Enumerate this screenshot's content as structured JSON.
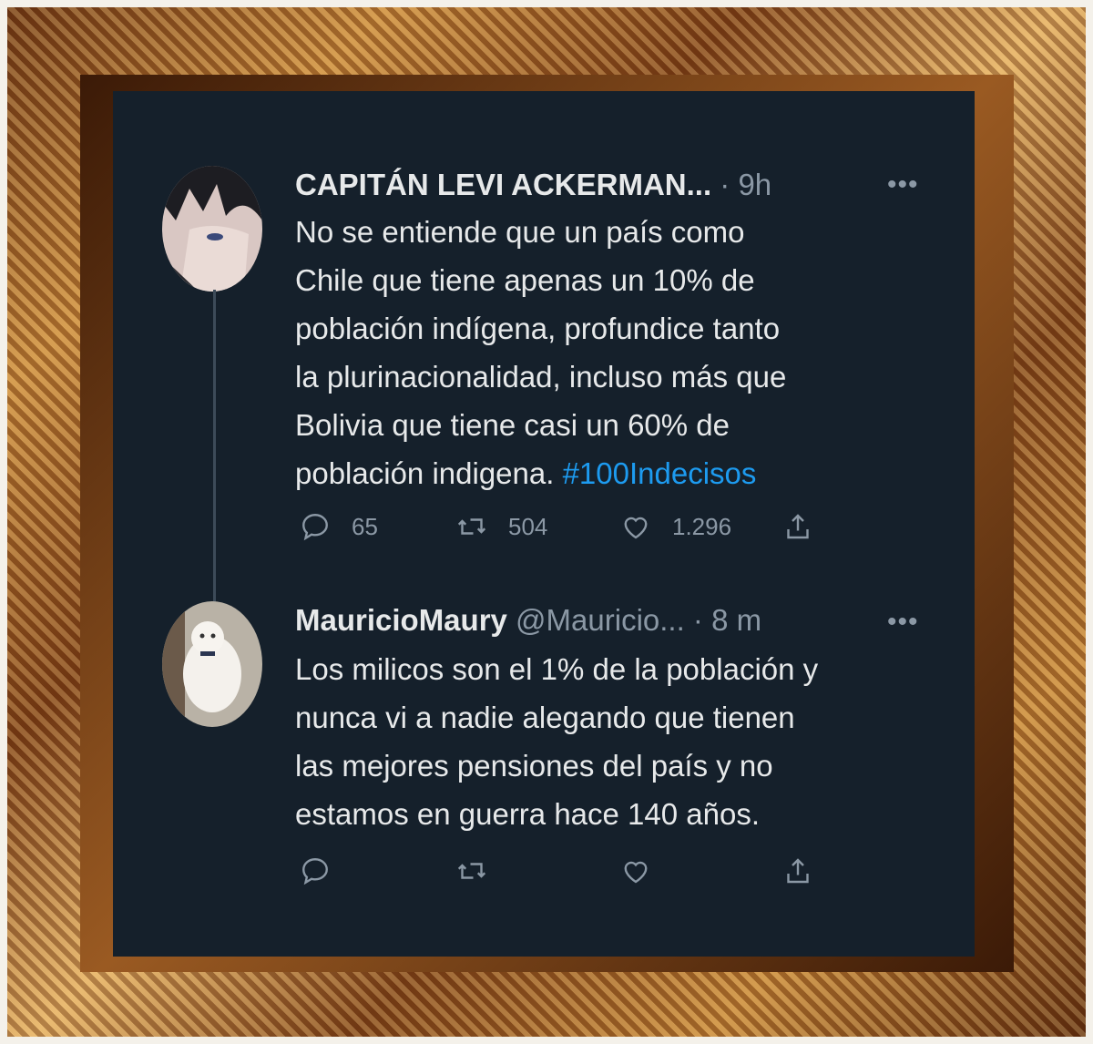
{
  "tweets": [
    {
      "display_name": "CAPITÁN LEVI ACKERMAN...",
      "handle": "",
      "time": " · 9h",
      "more": "•••",
      "text_lines": [
        "No se entiende que un país como",
        "Chile que tiene apenas un 10% de",
        "población indígena, profundice tanto",
        "la plurinacionalidad, incluso más que",
        "Bolivia que tiene casi un 60% de",
        "población indigena. "
      ],
      "hashtag": "#100Indecisos",
      "replies": "65",
      "retweets": "504",
      "likes": "1.296"
    },
    {
      "display_name": "MauricioMaury",
      "handle": " @Mauricio...",
      "time": " · 8 m",
      "more": "•••",
      "text_lines": [
        "Los milicos son el 1% de la población y",
        "nunca vi a nadie alegando que tienen",
        "las mejores pensiones del país y no",
        "estamos en guerra hace 140 años."
      ],
      "replies": "",
      "retweets": "",
      "likes": ""
    }
  ],
  "icons": [
    "reply-icon",
    "retweet-icon",
    "like-icon",
    "share-icon",
    "more-icon"
  ],
  "colors": {
    "background": "#15202b",
    "text": "#e7e9ea",
    "muted": "#8b98a5",
    "link": "#1d9bf0",
    "frame_gold": "#c98a3c"
  }
}
